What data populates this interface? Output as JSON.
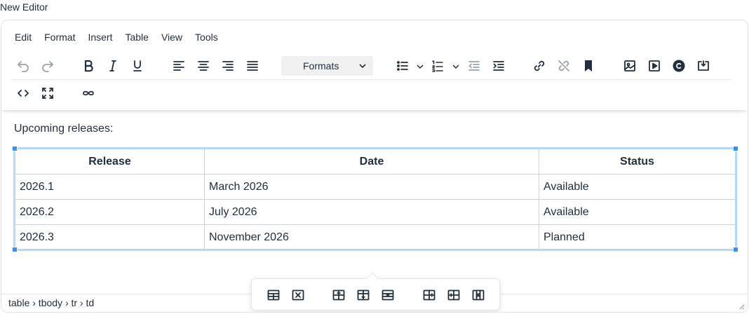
{
  "page_title": "New Editor",
  "menubar": {
    "items": [
      "Edit",
      "Format",
      "Insert",
      "Table",
      "View",
      "Tools"
    ]
  },
  "toolbar": {
    "formats_label": "Formats"
  },
  "content": {
    "intro": "Upcoming releases:",
    "table": {
      "headers": [
        "Release",
        "Date",
        "Status"
      ],
      "rows": [
        [
          "2026.1",
          "March 2026",
          "Available"
        ],
        [
          "2026.2",
          "July 2026",
          "Available"
        ],
        [
          "2026.3",
          "November 2026",
          "Planned"
        ]
      ]
    }
  },
  "statusbar": {
    "path": "table › tbody › tr › td"
  },
  "colors": {
    "selection": "#b4d7ff",
    "handle": "#3d8ef0",
    "text": "#222f3e"
  }
}
